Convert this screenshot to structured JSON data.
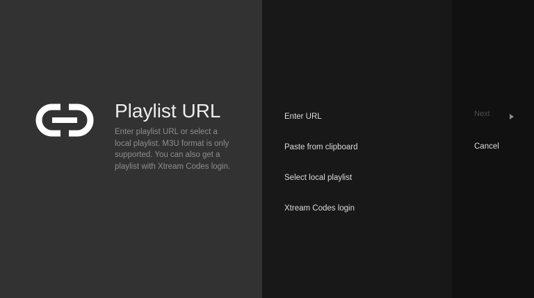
{
  "guidance": {
    "icon": "link-icon",
    "title": "Playlist URL",
    "description": "Enter playlist URL or select a local playlist. M3U format is only supported. You can also get a playlist with Xtream Codes login."
  },
  "actions": [
    {
      "label": "Enter URL"
    },
    {
      "label": "Paste from clipboard"
    },
    {
      "label": "Select local playlist"
    },
    {
      "label": "Xtream Codes login"
    }
  ],
  "buttons": {
    "next_label": "Next",
    "next_icon": "chevron-right-icon",
    "cancel_label": "Cancel"
  },
  "colors": {
    "guidance_background": "#323232",
    "actions_background": "#181818",
    "buttons_background": "#111111",
    "text_primary": "#dcdcdc",
    "text_secondary": "#8e8e8e",
    "text_disabled": "#4e4e4e"
  }
}
